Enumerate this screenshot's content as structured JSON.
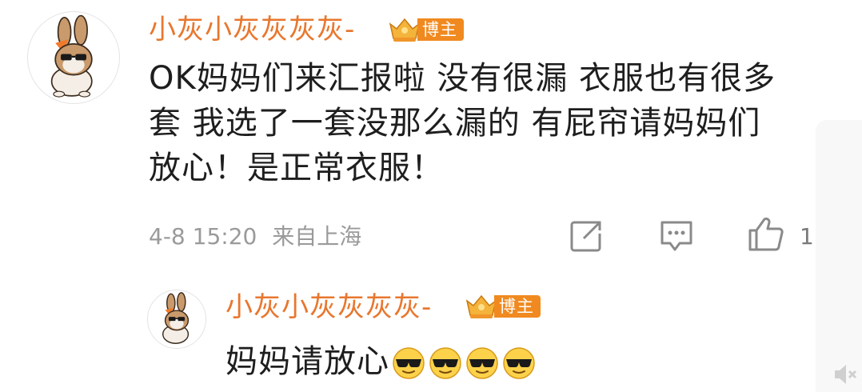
{
  "comment": {
    "username": "小灰小灰灰灰灰-",
    "badge_label": "博主",
    "text": "OK妈妈们来汇报啦 没有很漏 衣服也有很多套 我选了一套没那么漏的 有屁帘请妈妈们放心！是正常衣服！",
    "lines": [
      "OK妈妈们来汇报啦 没有很漏 衣服也有很多",
      "套 我选了一套没那么漏的 有屁帘请妈妈们",
      "放心！是正常衣服！"
    ],
    "timestamp": "4-8 15:20",
    "location": "来自上海",
    "like_count": "1",
    "icons": [
      "repost-icon",
      "comment-icon",
      "like-icon"
    ]
  },
  "reply": {
    "username": "小灰小灰灰灰灰-",
    "badge_label": "博主",
    "text": "妈妈请放心",
    "emojis": [
      "sunglasses-emoji",
      "sunglasses-emoji",
      "sunglasses-emoji",
      "sunglasses-emoji"
    ]
  },
  "colors": {
    "username": "#e8772e",
    "badge": "#f08a20",
    "text": "#1e1e1e",
    "meta": "#9a9a9a"
  }
}
